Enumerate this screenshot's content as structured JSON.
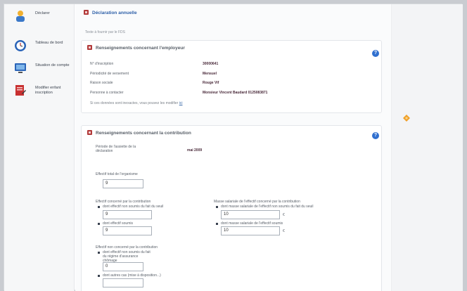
{
  "sidebar": {
    "items": [
      {
        "label": "Déclarer"
      },
      {
        "label": "Tableau de bord"
      },
      {
        "label": "Situation de compte"
      },
      {
        "label": "Modifier enfant inscription"
      }
    ]
  },
  "page": {
    "title": "Déclaration annuelle",
    "subtitle": "Texte à fournir par le FDS"
  },
  "employer": {
    "header": "Renseignements concernant l'employeur",
    "rows": [
      {
        "label": "N° d'inscription",
        "value": "30000641"
      },
      {
        "label": "Périodicité de versement",
        "value": "Mensuel"
      },
      {
        "label": "Raison sociale",
        "value": "Rouge Vif"
      },
      {
        "label": "Personne à contacter",
        "value": "Monsieur Vincent Baudard 0125083871"
      }
    ],
    "modif_text": "Si ces données sont inexactes, vous pouvez les modifier",
    "modif_link": "ici"
  },
  "contribution": {
    "header": "Renseignements concernant la contribution",
    "period_label": "Période de l'assiette de la déclaration",
    "period_value": "mai 2009",
    "effectif_total_label": "Effectif total de l'organisme",
    "effectif_total_value": "9",
    "effectif_concerne_label": "Effectif concerné par la contribution",
    "effectif_non_soumis_label": "dont effectif non soumis du fait du seuil",
    "effectif_non_soumis_value": "9",
    "effectif_soumis_label": "dont effectif soumis",
    "effectif_soumis_value": "9",
    "masse_label": "Masse salariale de l'effectif concerné par la contribution",
    "masse_non_soumis_label": "dont masse salariale de l'effectif non soumis du fait du seuil",
    "masse_non_soumis_value": "10",
    "masse_soumis_label": "dont masse salariale de l'effectif soumis",
    "masse_soumis_value": "10",
    "unit": "€",
    "effectif_non_concerne_label": "Effectif non concerné par la contribution",
    "effectif_non_soumis_regime_label": "dont effectif non soumis du fait du régime d'assurance chômage",
    "effectif_non_soumis_regime_value": "0",
    "autres_cas_label": "dont autres cas (mise à disposition...)",
    "autres_cas_value": ""
  },
  "colors": {
    "title_blue": "#2d5fa8",
    "section_icon_red": "#b23a3a",
    "help_blue": "#2f6fcf",
    "marker_orange": "#f0a028"
  }
}
